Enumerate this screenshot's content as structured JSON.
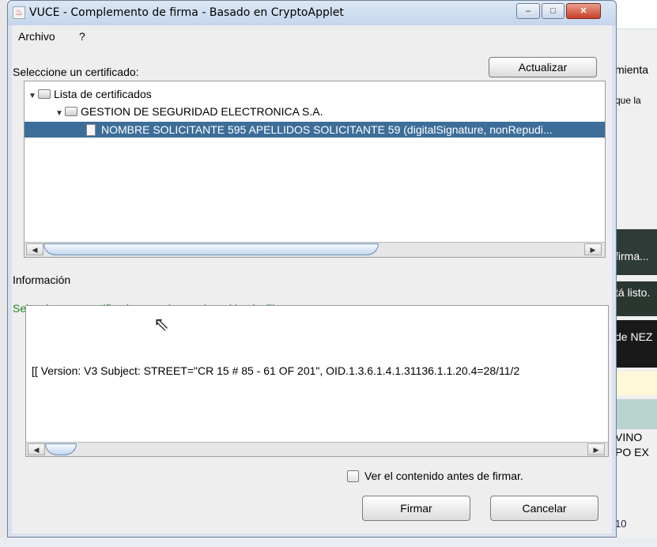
{
  "window": {
    "title": "VUCE - Complemento de firma - Basado en CryptoApplet",
    "controls": {
      "minimize": "–",
      "maximize": "□",
      "close": "✕"
    }
  },
  "menu": {
    "items": [
      "Archivo",
      "?"
    ]
  },
  "certificates": {
    "label": "Seleccione un certificado:",
    "refresh_button": "Actualizar",
    "tree": {
      "root": "Lista de certificados",
      "issuer": "GESTION DE SEGURIDAD ELECTRONICA S.A.",
      "selected": "NOMBRE SOLICITANTE 595 APELLIDOS SOLICITANTE 59 (digitalSignature, nonRepudi..."
    }
  },
  "information": {
    "heading": "Información",
    "message": "Seleccione su certificado y presione sobre el botón Firmar",
    "certificate_text": "[[  Version: V3  Subject: STREET=\"CR 15 # 85 - 61 OF 201\", OID.1.3.6.1.4.1.31136.1.1.20.4=28/11/2"
  },
  "verify_checkbox": {
    "label": "Ver el contenido antes de firmar.",
    "checked": false
  },
  "buttons": {
    "sign": "Firmar",
    "cancel": "Cancelar"
  },
  "background_right": [
    "mienta",
    "que la",
    "firma...",
    "tá listo.",
    "de NEZ",
    "VINO",
    "PO EX",
    "10"
  ],
  "colors": {
    "selection": "#3d6e99",
    "message_green": "#228b22",
    "window_frame": "#c4d6ec"
  }
}
